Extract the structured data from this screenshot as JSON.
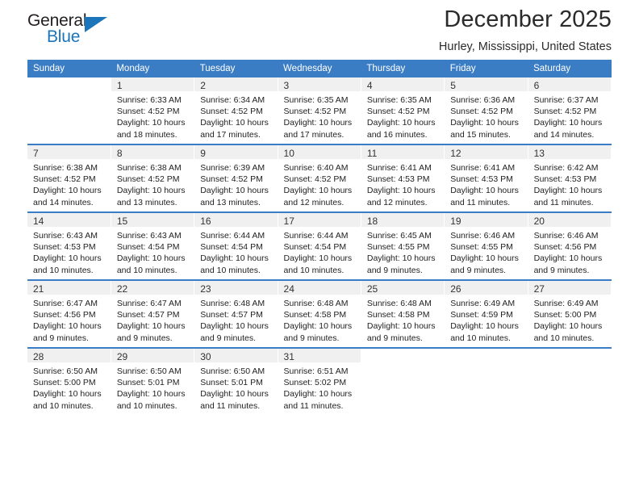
{
  "brand": {
    "name_part1": "General",
    "name_part2": "Blue",
    "triangle_color": "#1b75bb"
  },
  "header": {
    "month_title": "December 2025",
    "location": "Hurley, Mississippi, United States"
  },
  "theme": {
    "header_blue": "#3b7dc4",
    "daynum_band": "#f0f0f0",
    "text": "#222222"
  },
  "calendar": {
    "weekday_headers": [
      "Sunday",
      "Monday",
      "Tuesday",
      "Wednesday",
      "Thursday",
      "Friday",
      "Saturday"
    ],
    "labels": {
      "sunrise_prefix": "Sunrise: ",
      "sunset_prefix": "Sunset: ",
      "daylight_prefix": "Daylight: "
    },
    "weeks": [
      [
        {
          "day": "",
          "sunrise": "",
          "sunset": "",
          "daylight_line1": "",
          "daylight_line2": ""
        },
        {
          "day": "1",
          "sunrise": "Sunrise: 6:33 AM",
          "sunset": "Sunset: 4:52 PM",
          "daylight_line1": "Daylight: 10 hours",
          "daylight_line2": "and 18 minutes."
        },
        {
          "day": "2",
          "sunrise": "Sunrise: 6:34 AM",
          "sunset": "Sunset: 4:52 PM",
          "daylight_line1": "Daylight: 10 hours",
          "daylight_line2": "and 17 minutes."
        },
        {
          "day": "3",
          "sunrise": "Sunrise: 6:35 AM",
          "sunset": "Sunset: 4:52 PM",
          "daylight_line1": "Daylight: 10 hours",
          "daylight_line2": "and 17 minutes."
        },
        {
          "day": "4",
          "sunrise": "Sunrise: 6:35 AM",
          "sunset": "Sunset: 4:52 PM",
          "daylight_line1": "Daylight: 10 hours",
          "daylight_line2": "and 16 minutes."
        },
        {
          "day": "5",
          "sunrise": "Sunrise: 6:36 AM",
          "sunset": "Sunset: 4:52 PM",
          "daylight_line1": "Daylight: 10 hours",
          "daylight_line2": "and 15 minutes."
        },
        {
          "day": "6",
          "sunrise": "Sunrise: 6:37 AM",
          "sunset": "Sunset: 4:52 PM",
          "daylight_line1": "Daylight: 10 hours",
          "daylight_line2": "and 14 minutes."
        }
      ],
      [
        {
          "day": "7",
          "sunrise": "Sunrise: 6:38 AM",
          "sunset": "Sunset: 4:52 PM",
          "daylight_line1": "Daylight: 10 hours",
          "daylight_line2": "and 14 minutes."
        },
        {
          "day": "8",
          "sunrise": "Sunrise: 6:38 AM",
          "sunset": "Sunset: 4:52 PM",
          "daylight_line1": "Daylight: 10 hours",
          "daylight_line2": "and 13 minutes."
        },
        {
          "day": "9",
          "sunrise": "Sunrise: 6:39 AM",
          "sunset": "Sunset: 4:52 PM",
          "daylight_line1": "Daylight: 10 hours",
          "daylight_line2": "and 13 minutes."
        },
        {
          "day": "10",
          "sunrise": "Sunrise: 6:40 AM",
          "sunset": "Sunset: 4:52 PM",
          "daylight_line1": "Daylight: 10 hours",
          "daylight_line2": "and 12 minutes."
        },
        {
          "day": "11",
          "sunrise": "Sunrise: 6:41 AM",
          "sunset": "Sunset: 4:53 PM",
          "daylight_line1": "Daylight: 10 hours",
          "daylight_line2": "and 12 minutes."
        },
        {
          "day": "12",
          "sunrise": "Sunrise: 6:41 AM",
          "sunset": "Sunset: 4:53 PM",
          "daylight_line1": "Daylight: 10 hours",
          "daylight_line2": "and 11 minutes."
        },
        {
          "day": "13",
          "sunrise": "Sunrise: 6:42 AM",
          "sunset": "Sunset: 4:53 PM",
          "daylight_line1": "Daylight: 10 hours",
          "daylight_line2": "and 11 minutes."
        }
      ],
      [
        {
          "day": "14",
          "sunrise": "Sunrise: 6:43 AM",
          "sunset": "Sunset: 4:53 PM",
          "daylight_line1": "Daylight: 10 hours",
          "daylight_line2": "and 10 minutes."
        },
        {
          "day": "15",
          "sunrise": "Sunrise: 6:43 AM",
          "sunset": "Sunset: 4:54 PM",
          "daylight_line1": "Daylight: 10 hours",
          "daylight_line2": "and 10 minutes."
        },
        {
          "day": "16",
          "sunrise": "Sunrise: 6:44 AM",
          "sunset": "Sunset: 4:54 PM",
          "daylight_line1": "Daylight: 10 hours",
          "daylight_line2": "and 10 minutes."
        },
        {
          "day": "17",
          "sunrise": "Sunrise: 6:44 AM",
          "sunset": "Sunset: 4:54 PM",
          "daylight_line1": "Daylight: 10 hours",
          "daylight_line2": "and 10 minutes."
        },
        {
          "day": "18",
          "sunrise": "Sunrise: 6:45 AM",
          "sunset": "Sunset: 4:55 PM",
          "daylight_line1": "Daylight: 10 hours",
          "daylight_line2": "and 9 minutes."
        },
        {
          "day": "19",
          "sunrise": "Sunrise: 6:46 AM",
          "sunset": "Sunset: 4:55 PM",
          "daylight_line1": "Daylight: 10 hours",
          "daylight_line2": "and 9 minutes."
        },
        {
          "day": "20",
          "sunrise": "Sunrise: 6:46 AM",
          "sunset": "Sunset: 4:56 PM",
          "daylight_line1": "Daylight: 10 hours",
          "daylight_line2": "and 9 minutes."
        }
      ],
      [
        {
          "day": "21",
          "sunrise": "Sunrise: 6:47 AM",
          "sunset": "Sunset: 4:56 PM",
          "daylight_line1": "Daylight: 10 hours",
          "daylight_line2": "and 9 minutes."
        },
        {
          "day": "22",
          "sunrise": "Sunrise: 6:47 AM",
          "sunset": "Sunset: 4:57 PM",
          "daylight_line1": "Daylight: 10 hours",
          "daylight_line2": "and 9 minutes."
        },
        {
          "day": "23",
          "sunrise": "Sunrise: 6:48 AM",
          "sunset": "Sunset: 4:57 PM",
          "daylight_line1": "Daylight: 10 hours",
          "daylight_line2": "and 9 minutes."
        },
        {
          "day": "24",
          "sunrise": "Sunrise: 6:48 AM",
          "sunset": "Sunset: 4:58 PM",
          "daylight_line1": "Daylight: 10 hours",
          "daylight_line2": "and 9 minutes."
        },
        {
          "day": "25",
          "sunrise": "Sunrise: 6:48 AM",
          "sunset": "Sunset: 4:58 PM",
          "daylight_line1": "Daylight: 10 hours",
          "daylight_line2": "and 9 minutes."
        },
        {
          "day": "26",
          "sunrise": "Sunrise: 6:49 AM",
          "sunset": "Sunset: 4:59 PM",
          "daylight_line1": "Daylight: 10 hours",
          "daylight_line2": "and 10 minutes."
        },
        {
          "day": "27",
          "sunrise": "Sunrise: 6:49 AM",
          "sunset": "Sunset: 5:00 PM",
          "daylight_line1": "Daylight: 10 hours",
          "daylight_line2": "and 10 minutes."
        }
      ],
      [
        {
          "day": "28",
          "sunrise": "Sunrise: 6:50 AM",
          "sunset": "Sunset: 5:00 PM",
          "daylight_line1": "Daylight: 10 hours",
          "daylight_line2": "and 10 minutes."
        },
        {
          "day": "29",
          "sunrise": "Sunrise: 6:50 AM",
          "sunset": "Sunset: 5:01 PM",
          "daylight_line1": "Daylight: 10 hours",
          "daylight_line2": "and 10 minutes."
        },
        {
          "day": "30",
          "sunrise": "Sunrise: 6:50 AM",
          "sunset": "Sunset: 5:01 PM",
          "daylight_line1": "Daylight: 10 hours",
          "daylight_line2": "and 11 minutes."
        },
        {
          "day": "31",
          "sunrise": "Sunrise: 6:51 AM",
          "sunset": "Sunset: 5:02 PM",
          "daylight_line1": "Daylight: 10 hours",
          "daylight_line2": "and 11 minutes."
        },
        {
          "day": "",
          "sunrise": "",
          "sunset": "",
          "daylight_line1": "",
          "daylight_line2": ""
        },
        {
          "day": "",
          "sunrise": "",
          "sunset": "",
          "daylight_line1": "",
          "daylight_line2": ""
        },
        {
          "day": "",
          "sunrise": "",
          "sunset": "",
          "daylight_line1": "",
          "daylight_line2": ""
        }
      ]
    ]
  }
}
